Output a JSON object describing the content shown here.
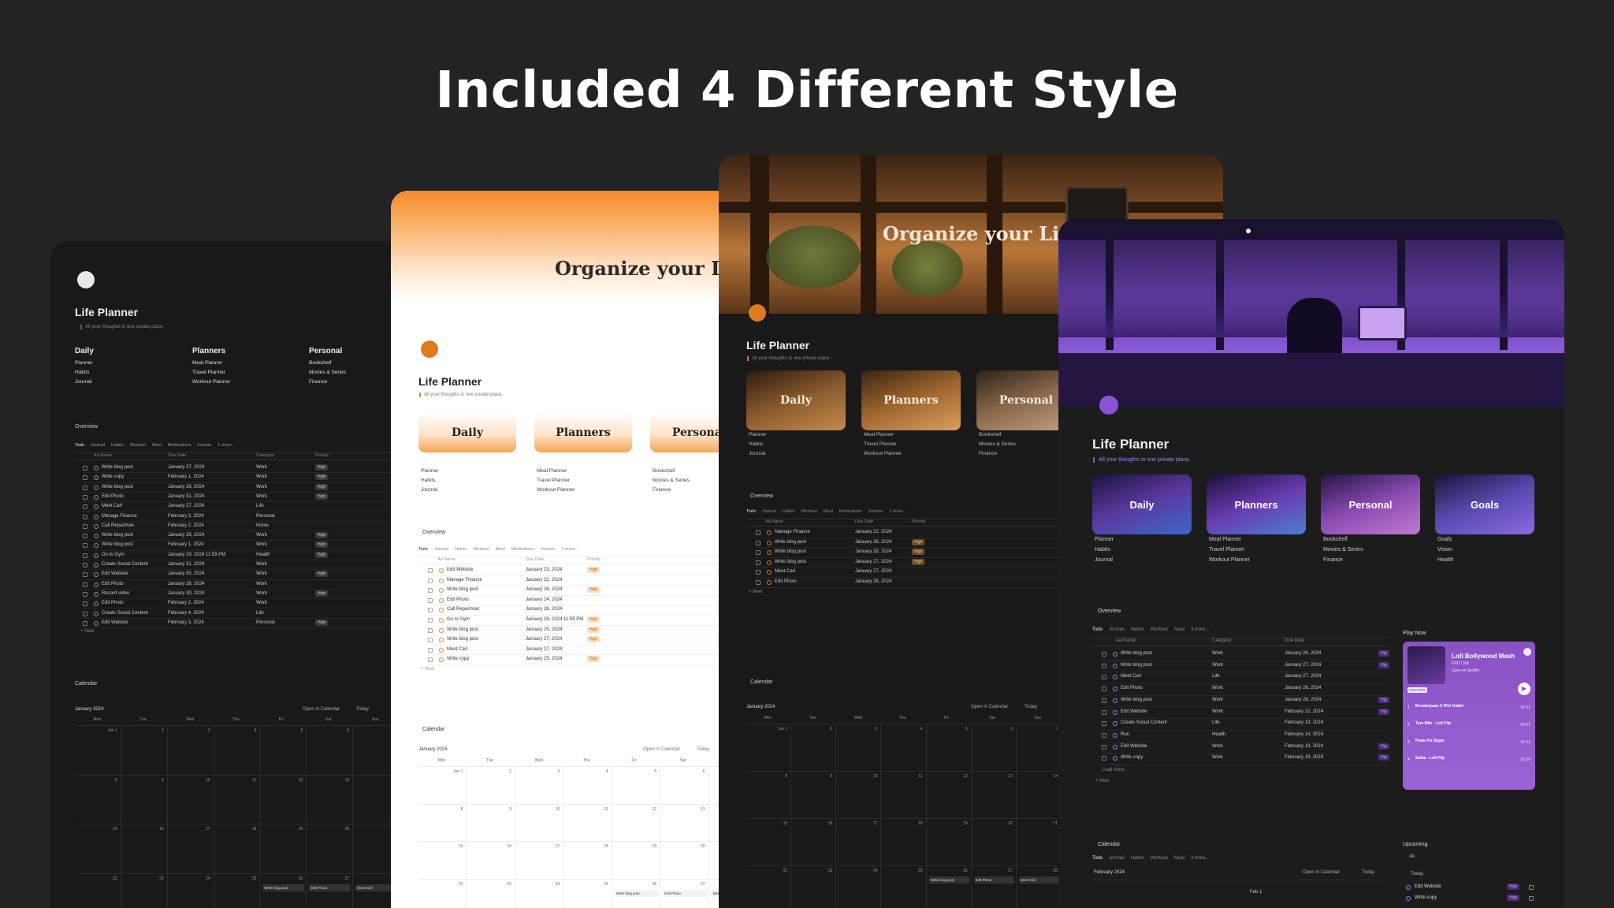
{
  "headline": "Included 4 Different Style",
  "brand": {
    "orange": "#f08a2c",
    "purple": "#8a52d6",
    "high": "#6b4c2a"
  },
  "common": {
    "app_title": "Life Planner",
    "tagline": "All your thoughts in one private place.",
    "cover_title": "Organize your Life.",
    "overview": "Overview",
    "calendar": "Calendar",
    "calendar_month": "January 2024",
    "open_in_calendar": "Open in Calendar",
    "today": "Today",
    "new": "+ New"
  },
  "sections": {
    "daily": {
      "label": "Daily",
      "links": [
        "Planner",
        "Habits",
        "Journal"
      ]
    },
    "planners": {
      "label": "Planners",
      "links": [
        "Meal Planner",
        "Travel Planner",
        "Workout Planner"
      ]
    },
    "personal": {
      "label": "Personal",
      "links": [
        "Bookshelf",
        "Movies & Series",
        "Finance"
      ]
    },
    "goals": {
      "label": "Goals",
      "links": [
        "Goals",
        "Vision",
        "Health"
      ]
    }
  },
  "tabs": [
    "Todo",
    "Journal",
    "Habits",
    "Workout",
    "Meal",
    "Medications",
    "Income",
    "1 more..."
  ],
  "table_headers": {
    "name": "Aa Name",
    "due": "Due Date",
    "category": "Category",
    "priority": "Priority"
  },
  "dark_rows": [
    {
      "name": "Write blog post",
      "due": "January 27, 2024",
      "cat": "Work",
      "pri": "High"
    },
    {
      "name": "Write copy",
      "due": "February 1, 2024",
      "cat": "Work",
      "pri": "High"
    },
    {
      "name": "Write blog post",
      "due": "January 26, 2024",
      "cat": "Work",
      "pri": "High"
    },
    {
      "name": "Edit Photo",
      "due": "January 31, 2024",
      "cat": "Work",
      "pri": "High"
    },
    {
      "name": "Meet Carl",
      "due": "January 27, 2024",
      "cat": "Life",
      "pri": ""
    },
    {
      "name": "Manage Finance",
      "due": "February 3, 2024",
      "cat": "Personal",
      "pri": ""
    },
    {
      "name": "Call Repairman",
      "due": "February 2, 2024",
      "cat": "Home",
      "pri": ""
    },
    {
      "name": "Write blog post",
      "due": "January 28, 2024",
      "cat": "Work",
      "pri": "High"
    },
    {
      "name": "Write blog post",
      "due": "February 1, 2024",
      "cat": "Work",
      "pri": "High"
    },
    {
      "name": "Go to Gym",
      "due": "January 29, 2024 11:59 PM",
      "cat": "Health",
      "pri": "High"
    },
    {
      "name": "Create Social Content",
      "due": "January 31, 2024",
      "cat": "Work",
      "pri": ""
    },
    {
      "name": "Edit Website",
      "due": "January 30, 2024",
      "cat": "Work",
      "pri": "High"
    },
    {
      "name": "Edit Photo",
      "due": "January 28, 2024",
      "cat": "Work",
      "pri": ""
    },
    {
      "name": "Record video",
      "due": "January 30, 2024",
      "cat": "Work",
      "pri": "High"
    },
    {
      "name": "Edit Photo",
      "due": "February 2, 2024",
      "cat": "Work",
      "pri": ""
    },
    {
      "name": "Create Social Content",
      "due": "February 4, 2024",
      "cat": "Life",
      "pri": ""
    },
    {
      "name": "Edit Website",
      "due": "February 3, 2024",
      "cat": "Personal",
      "pri": "High"
    }
  ],
  "light_rows": [
    {
      "name": "Edit Website",
      "due": "January 23, 2024",
      "pri": "High"
    },
    {
      "name": "Manage Finance",
      "due": "January 22, 2024",
      "pri": ""
    },
    {
      "name": "Write blog post",
      "due": "January 26, 2024",
      "pri": "High"
    },
    {
      "name": "Edit Photo",
      "due": "January 24, 2024",
      "pri": ""
    },
    {
      "name": "Call Repairman",
      "due": "January 26, 2024",
      "pri": ""
    },
    {
      "name": "Go to Gym",
      "due": "January 26, 2024 11:59 PM",
      "pri": "High"
    },
    {
      "name": "Write blog post",
      "due": "January 25, 2024",
      "pri": "High"
    },
    {
      "name": "Write blog post",
      "due": "January 27, 2024",
      "pri": "High"
    },
    {
      "name": "Meet Carl",
      "due": "January 27, 2024",
      "pri": ""
    },
    {
      "name": "Write copy",
      "due": "January 25, 2024",
      "pri": "High"
    }
  ],
  "cozy_rows": [
    {
      "name": "Manage Finance",
      "due": "January 22, 2024",
      "pri": ""
    },
    {
      "name": "Write blog post",
      "due": "January 26, 2024",
      "pri": "High"
    },
    {
      "name": "Write blog post",
      "due": "January 28, 2024",
      "pri": "High"
    },
    {
      "name": "Write blog post",
      "due": "January 27, 2024",
      "pri": "High"
    },
    {
      "name": "Meet Carl",
      "due": "January 27, 2024",
      "pri": ""
    },
    {
      "name": "Edit Photo",
      "due": "January 28, 2024",
      "pri": ""
    }
  ],
  "purple_rows": [
    {
      "name": "Write blog post",
      "cat": "Work",
      "due": "January 26, 2024",
      "pri": "Hig"
    },
    {
      "name": "Write blog post",
      "cat": "Work",
      "due": "January 27, 2024",
      "pri": "Hig"
    },
    {
      "name": "Meet Carl",
      "cat": "Life",
      "due": "January 27, 2024",
      "pri": ""
    },
    {
      "name": "Edit Photo",
      "cat": "Work",
      "due": "January 28, 2024",
      "pri": ""
    },
    {
      "name": "Write blog post",
      "cat": "Work",
      "due": "January 28, 2024",
      "pri": "Hig"
    },
    {
      "name": "Edit Website",
      "cat": "Work",
      "due": "February 12, 2024",
      "pri": "Hig"
    },
    {
      "name": "Create Social Content",
      "cat": "Life",
      "due": "February 13, 2024",
      "pri": ""
    },
    {
      "name": "Run",
      "cat": "Health",
      "due": "February 14, 2024",
      "pri": ""
    },
    {
      "name": "Edit Website",
      "cat": "Work",
      "due": "February 19, 2024",
      "pri": "Hig"
    },
    {
      "name": "Write copy",
      "cat": "Work",
      "due": "February 19, 2024",
      "pri": "Hig"
    }
  ],
  "purple": {
    "purple_tabs": [
      "Todo",
      "Journal",
      "Habits",
      "Workout",
      "Meal",
      "3 more..."
    ],
    "load_more": "Load more",
    "play_now": "Play Now",
    "player_title": "Lofi Bollywood Mash",
    "player_sub": "PRD Chill",
    "save_spotify": "Save on Spotify",
    "preview": "PREVIEW",
    "tracks": [
      {
        "n": "1",
        "t": "Besabriyaan X Phir Kabhi",
        "d": "02:43"
      },
      {
        "n": "2",
        "t": "Tum Mile - Lofi Flip",
        "d": "04:02"
      },
      {
        "n": "3",
        "t": "Pyaar Ka Sagar",
        "d": "02:34"
      },
      {
        "n": "4",
        "t": "Saiba - Lofi Flip",
        "d": "02:25"
      }
    ],
    "calendar_month": "February 2024",
    "upcoming": "Upcoming",
    "upcoming_all": "All",
    "upcoming_today": "Today",
    "upcoming_items": [
      {
        "name": "Edit Website",
        "pri": "High"
      },
      {
        "name": "Write copy",
        "pri": "High"
      }
    ]
  },
  "weekdays": [
    "Mon",
    "Tue",
    "Wed",
    "Thu",
    "Fri",
    "Sat",
    "Sun"
  ],
  "cal_days": [
    "Jan 1",
    "2",
    "3",
    "4",
    "5",
    "6",
    "7",
    "8",
    "9",
    "10",
    "11",
    "12",
    "13",
    "14",
    "15",
    "16",
    "17",
    "18",
    "19",
    "20",
    "21",
    "22",
    "23",
    "24",
    "25",
    "26",
    "27",
    "28"
  ],
  "cal_events": [
    "Write blog post",
    "Edit Photo",
    "Meet Carl",
    "Manage Finance",
    "Go to Gym",
    "Edit Website",
    "Write copy",
    "Call Repairman",
    "Create Social Content"
  ]
}
